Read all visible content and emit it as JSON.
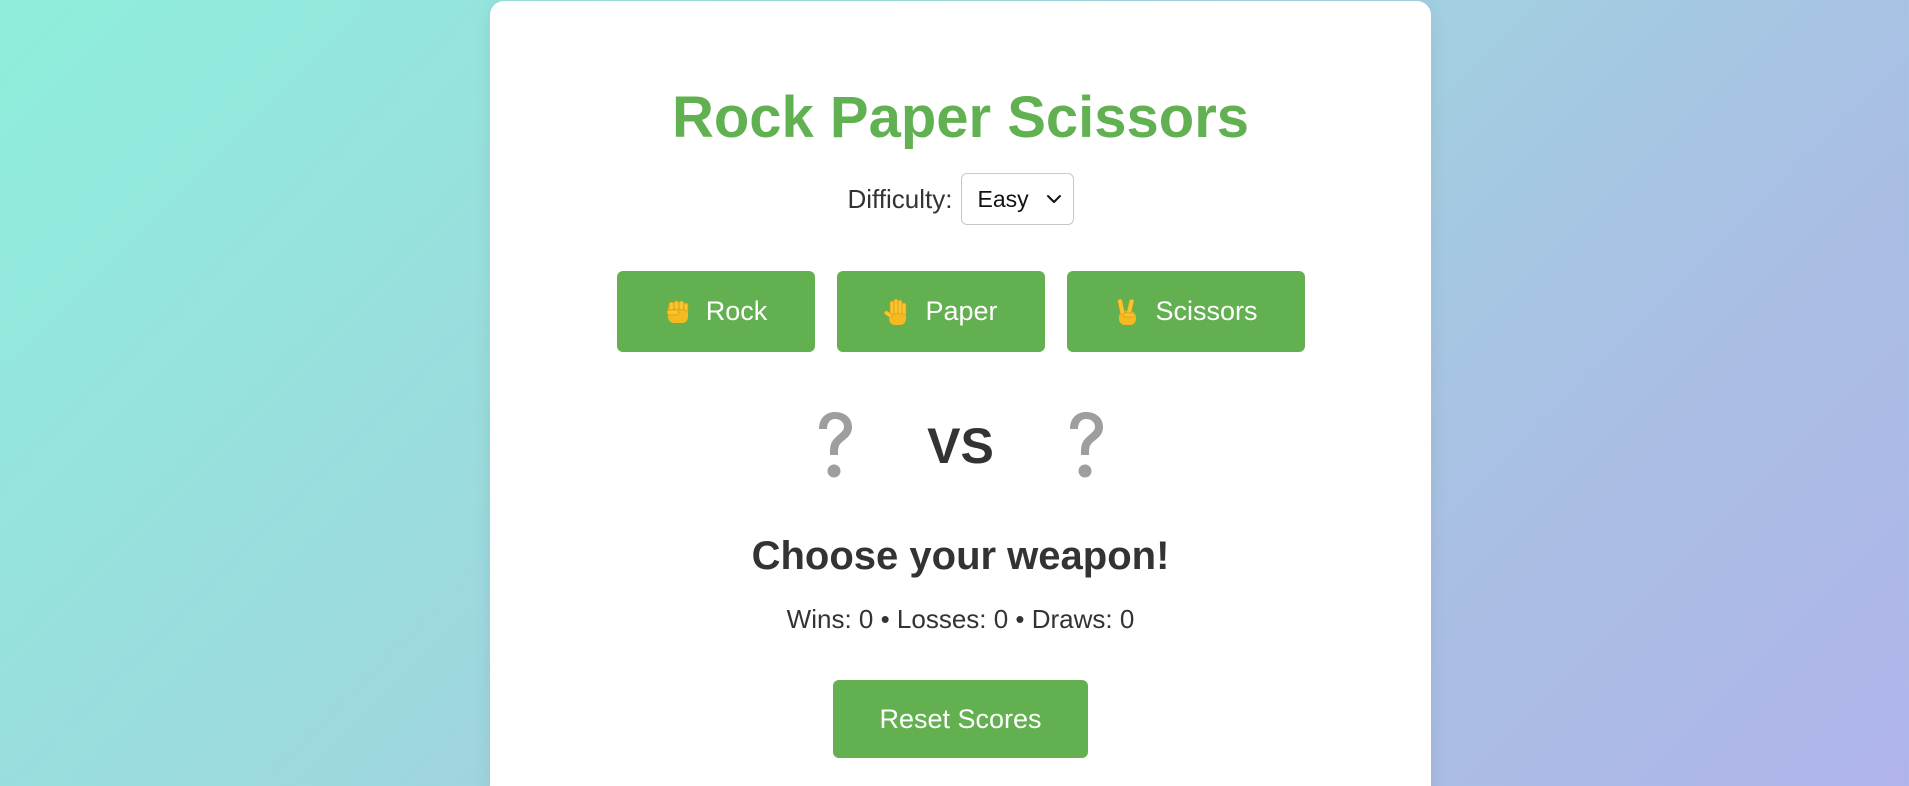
{
  "app": {
    "title": "Rock Paper Scissors"
  },
  "difficulty": {
    "label": "Difficulty:",
    "selected": "Easy"
  },
  "choices": [
    {
      "label": "Rock",
      "icon": "raised-fist-icon"
    },
    {
      "label": "Paper",
      "icon": "raised-hand-icon"
    },
    {
      "label": "Scissors",
      "icon": "victory-hand-icon"
    }
  ],
  "versus": {
    "player": "?",
    "vs_label": "VS",
    "computer": "?"
  },
  "result": {
    "message": "Choose your weapon!"
  },
  "scores": {
    "text": "Wins: 0 • Losses: 0 • Draws: 0"
  },
  "reset": {
    "label": "Reset Scores"
  },
  "colors": {
    "accent": "#61b152",
    "button": "#62b050",
    "text": "#333333",
    "question": "#9e9e9e"
  }
}
